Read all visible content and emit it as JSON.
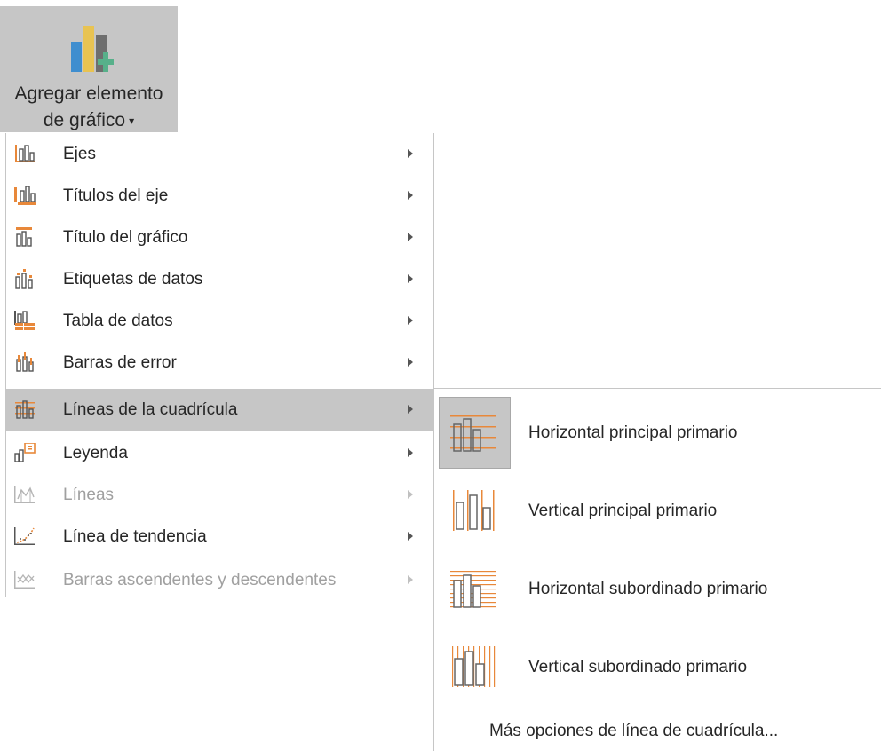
{
  "ribbon_button": {
    "line1": "Agregar elemento",
    "line2": "de gráfico",
    "icon": "add-chart-element-icon"
  },
  "menu": {
    "items": [
      {
        "label": "Ejes",
        "icon": "axes-icon",
        "enabled": true
      },
      {
        "label": "Títulos del eje",
        "icon": "axis-titles-icon",
        "enabled": true
      },
      {
        "label": "Título del gráfico",
        "icon": "chart-title-icon",
        "enabled": true
      },
      {
        "label": "Etiquetas de datos",
        "icon": "data-labels-icon",
        "enabled": true
      },
      {
        "label": "Tabla de datos",
        "icon": "data-table-icon",
        "enabled": true
      },
      {
        "label": "Barras de error",
        "icon": "error-bars-icon",
        "enabled": true
      },
      {
        "label": "Líneas de la cuadrícula",
        "icon": "gridlines-icon",
        "enabled": true,
        "active": true
      },
      {
        "label": "Leyenda",
        "icon": "legend-icon",
        "enabled": true
      },
      {
        "label": "Líneas",
        "icon": "lines-icon",
        "enabled": false
      },
      {
        "label": "Línea de tendencia",
        "icon": "trendline-icon",
        "enabled": true
      },
      {
        "label": "Barras ascendentes y descendentes",
        "icon": "up-down-bars-icon",
        "enabled": false
      }
    ]
  },
  "submenu": {
    "items": [
      {
        "label": "Horizontal principal primario",
        "icon": "horizontal-major-gridlines-icon",
        "selected": true
      },
      {
        "label": "Vertical principal primario",
        "icon": "vertical-major-gridlines-icon",
        "selected": false
      },
      {
        "label": "Horizontal subordinado primario",
        "icon": "horizontal-minor-gridlines-icon",
        "selected": false
      },
      {
        "label": "Vertical subordinado primario",
        "icon": "vertical-minor-gridlines-icon",
        "selected": false
      }
    ],
    "more_options": "Más opciones de línea de cuadrícula..."
  },
  "colors": {
    "accent_orange": "#e8883a",
    "highlight": "#c6c6c6",
    "disabled_text": "#a0a0a0"
  }
}
